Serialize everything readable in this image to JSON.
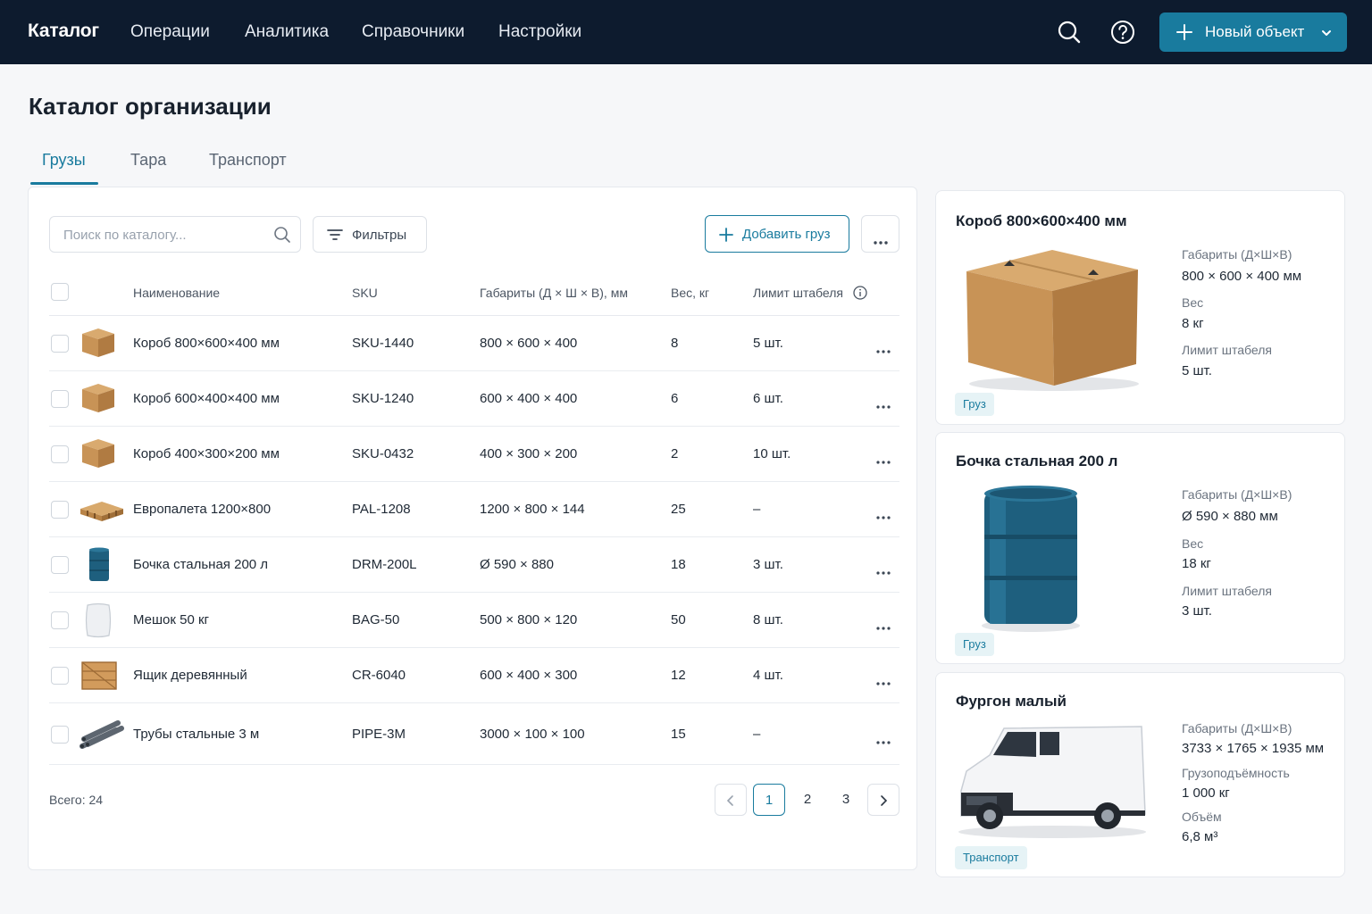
{
  "topbar": {
    "brand": "Каталог",
    "nav": [
      "Операции",
      "Аналитика",
      "Справочники",
      "Настройки"
    ],
    "new_button": "Новый объект"
  },
  "page": {
    "title": "Каталог организации"
  },
  "tabs": [
    "Грузы",
    "Тара",
    "Транспорт"
  ],
  "toolbar": {
    "search_placeholder": "Поиск по каталогу...",
    "filters": "Фильтры",
    "add": "Добавить груз"
  },
  "table": {
    "columns": [
      "Наименование",
      "SKU",
      "Габариты (Д × Ш × В), мм",
      "Вес, кг",
      "Лимит штабеля"
    ],
    "rows": [
      {
        "name": "Короб 800×600×400 мм",
        "sku": "SKU-1440",
        "dims": "800 × 600 × 400",
        "weight": "8",
        "limit": "5 шт.",
        "icon": "box-icon"
      },
      {
        "name": "Короб 600×400×400 мм",
        "sku": "SKU-1240",
        "dims": "600 × 400 × 400",
        "weight": "6",
        "limit": "6 шт.",
        "icon": "box-icon"
      },
      {
        "name": "Короб 400×300×200 мм",
        "sku": "SKU-0432",
        "dims": "400 × 300 × 200",
        "weight": "2",
        "limit": "10 шт.",
        "icon": "box-icon"
      },
      {
        "name": "Европалета 1200×800",
        "sku": "PAL-1208",
        "dims": "1200 × 800 × 144",
        "weight": "25",
        "limit": "–",
        "icon": "pallet-icon"
      },
      {
        "name": "Бочка стальная 200 л",
        "sku": "DRM-200L",
        "dims": "Ø 590 × 880",
        "weight": "18",
        "limit": "3 шт.",
        "icon": "drum-icon"
      },
      {
        "name": "Мешок 50 кг",
        "sku": "BAG-50",
        "dims": "500 × 800 × 120",
        "weight": "50",
        "limit": "8 шт.",
        "icon": "sack-icon"
      },
      {
        "name": "Ящик деревянный",
        "sku": "CR-6040",
        "dims": "600 × 400 × 300",
        "weight": "12",
        "limit": "4 шт.",
        "icon": "crate-icon"
      },
      {
        "name": "Трубы стальные 3 м",
        "sku": "PIPE-3M",
        "dims": "3000 × 100 × 100",
        "weight": "15",
        "limit": "–",
        "icon": "pipes-icon"
      }
    ],
    "total": "Всего: 24",
    "pages": [
      "1",
      "2",
      "3"
    ],
    "current_page": "1"
  },
  "cards": [
    {
      "title": "Короб 800×600×400 мм",
      "fields": [
        {
          "label": "Габариты (Д×Ш×В)",
          "value": "800 × 600 × 400 мм"
        },
        {
          "label": "Вес",
          "value": "8 кг"
        },
        {
          "label": "Лимит штабеля",
          "value": "5 шт."
        }
      ],
      "badge": "Груз"
    },
    {
      "title": "Бочка стальная 200 л",
      "fields": [
        {
          "label": "Габариты (Д×Ш×В)",
          "value": "Ø 590 × 880 мм"
        },
        {
          "label": "Вес",
          "value": "18 кг"
        },
        {
          "label": "Лимит штабеля",
          "value": "3 шт."
        }
      ],
      "badge": "Груз"
    },
    {
      "title": "Фургон малый",
      "fields": [
        {
          "label": "Габариты (Д×Ш×В)",
          "value": "3733 × 1765 × 1935 мм"
        },
        {
          "label": "Грузоподъёмность",
          "value": "1 000 кг"
        },
        {
          "label": "Объём",
          "value": "6,8 м³"
        }
      ],
      "badge": "Транспорт"
    }
  ],
  "colors": {
    "accent": "#197b9e",
    "topbar": "#0d1b2e",
    "badge_bg": "#e6f3f6"
  }
}
